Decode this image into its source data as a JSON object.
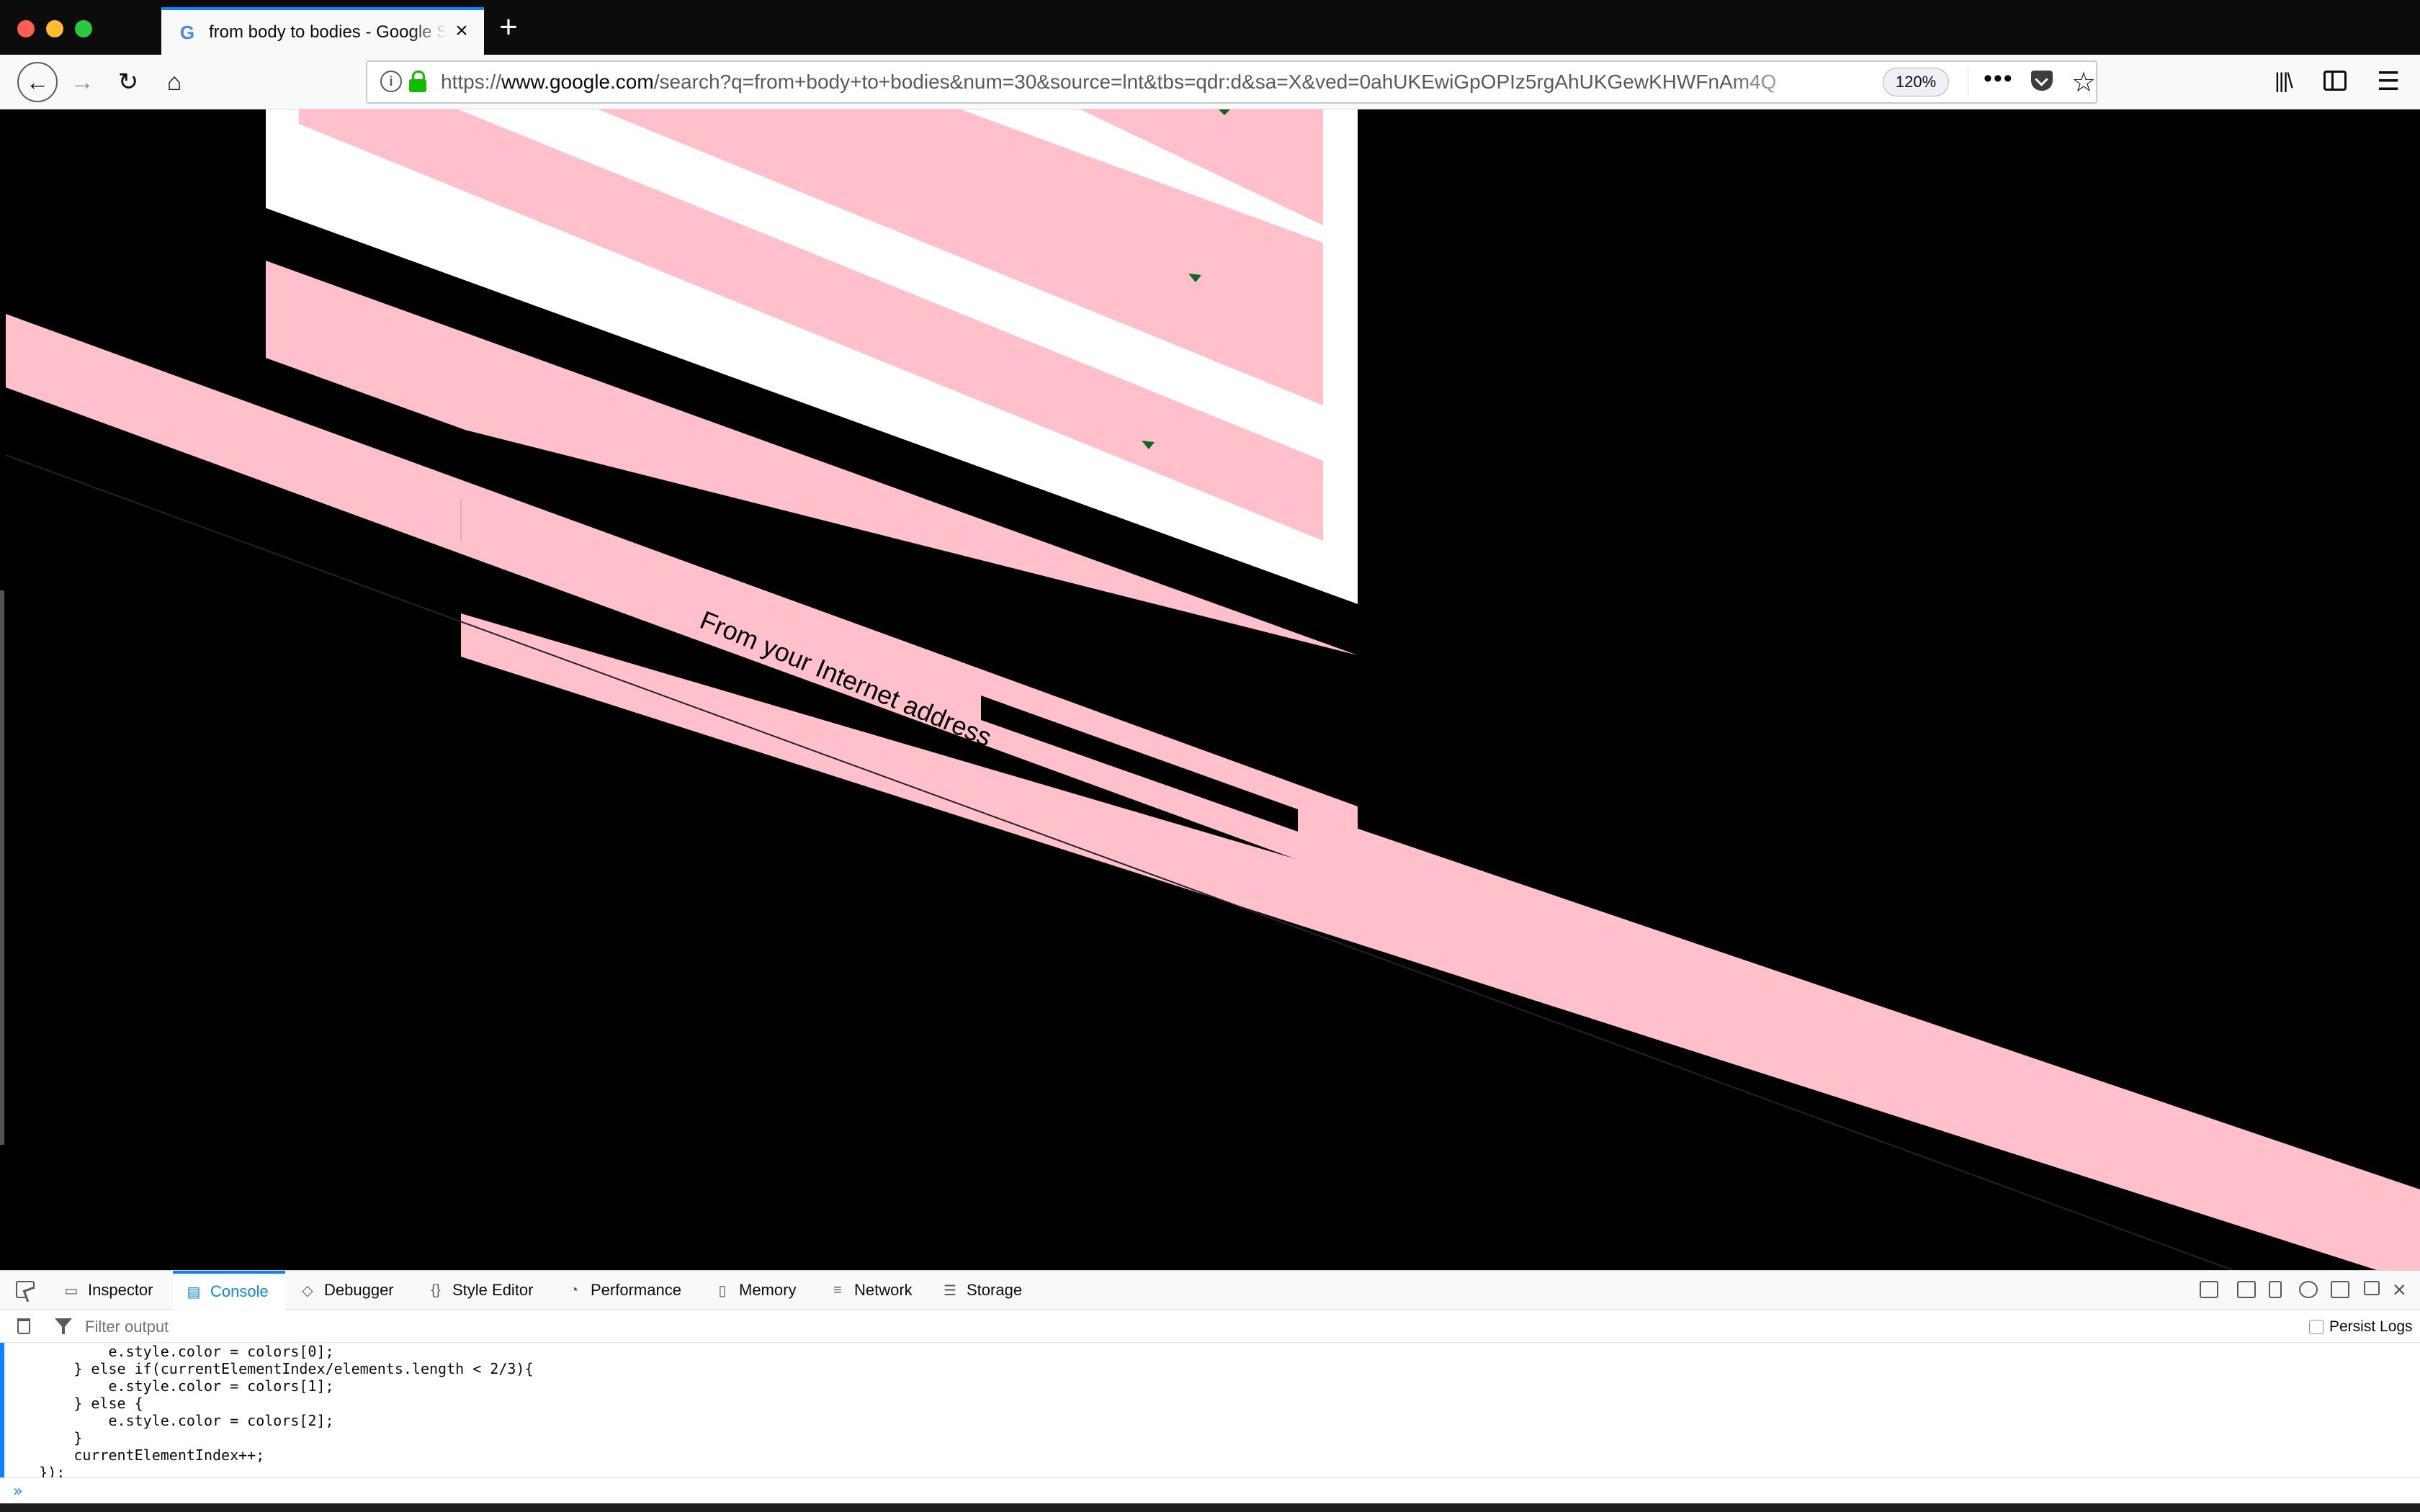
{
  "browser": {
    "tab": {
      "title": "from body to bodies - Google Search",
      "favicon": "G"
    },
    "url": {
      "scheme": "https://",
      "host": "www.google.com",
      "path": "/search?q=from+body+to+bodies&num=30&source=lnt&tbs=qdr:d&sa=X&ved=0ahUKEwiGpOPIz5rgAhUKGewKHWFnAm4Q",
      "zoom": "120%"
    },
    "toolbar": {
      "more_glyph": "•••",
      "star_glyph": "☆",
      "library_glyph": "|||\\",
      "menu_glyph": "☰"
    }
  },
  "page": {
    "rotated_text": "From your Internet address",
    "colors": {
      "pink": "#ffc0cb",
      "white": "#ffffff",
      "black": "#000000",
      "marker_green": "#0b6623"
    }
  },
  "devtools": {
    "tabs": [
      {
        "label": "Inspector",
        "icon": "inspector-icon",
        "active": false
      },
      {
        "label": "Console",
        "icon": "console-icon",
        "active": true
      },
      {
        "label": "Debugger",
        "icon": "debugger-icon",
        "active": false
      },
      {
        "label": "Style Editor",
        "icon": "style-editor-icon",
        "active": false
      },
      {
        "label": "Performance",
        "icon": "performance-icon",
        "active": false
      },
      {
        "label": "Memory",
        "icon": "memory-icon",
        "active": false
      },
      {
        "label": "Network",
        "icon": "network-icon",
        "active": false
      },
      {
        "label": "Storage",
        "icon": "storage-icon",
        "active": false
      }
    ],
    "filter_placeholder": "Filter output",
    "persist_logs": "Persist Logs",
    "code_lines": [
      "            e.style.color = colors[0];",
      "        } else if(currentElementIndex/elements.length < 2/3){",
      "            e.style.color = colors[1];",
      "        } else {",
      "            e.style.color = colors[2];",
      "        }",
      "        currentElementIndex++;",
      "    });"
    ],
    "prompt": "»"
  }
}
